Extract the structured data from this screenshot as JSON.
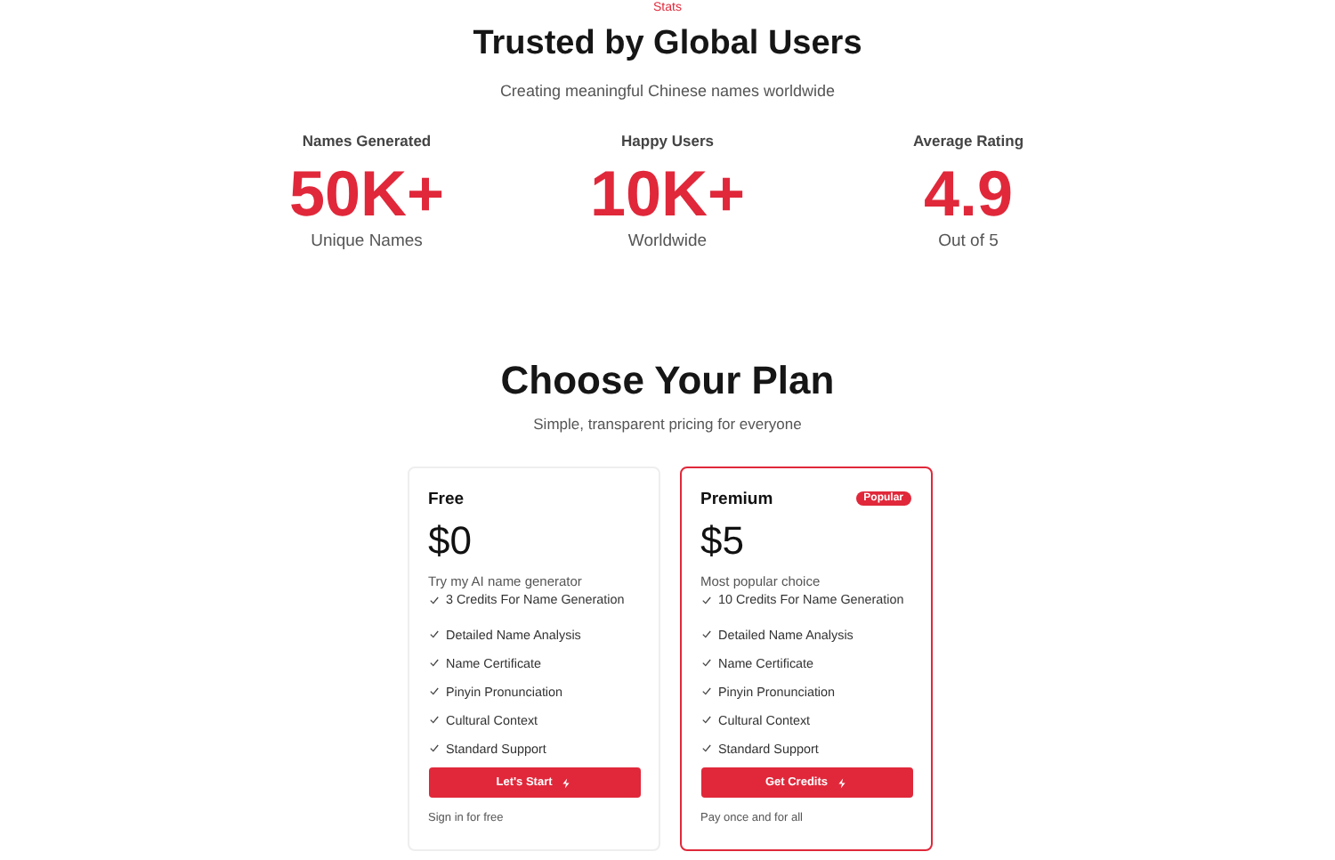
{
  "stats_section": {
    "eyebrow": "Stats",
    "title": "Trusted by Global Users",
    "subtitle": "Creating meaningful Chinese names worldwide",
    "stats": [
      {
        "label": "Names Generated",
        "value": "50K+",
        "caption": "Unique Names"
      },
      {
        "label": "Happy Users",
        "value": "10K+",
        "caption": "Worldwide"
      },
      {
        "label": "Average Rating",
        "value": "4.9",
        "caption": "Out of 5"
      }
    ]
  },
  "pricing": {
    "title": "Choose Your Plan",
    "subtitle": "Simple, transparent pricing for everyone",
    "plans": [
      {
        "name": "Free",
        "price": "$0",
        "description": "Try my AI name generator",
        "featured": false,
        "features": [
          "3 Credits For Name Generation",
          "Detailed Name Analysis",
          "Name Certificate",
          "Pinyin Pronunciation",
          "Cultural Context",
          "Standard Support"
        ],
        "button": "Let's Start",
        "note": "Sign in for free"
      },
      {
        "name": "Premium",
        "badge": "Popular",
        "price": "$5",
        "description": "Most popular choice",
        "featured": true,
        "features": [
          "10 Credits For Name Generation",
          "Detailed Name Analysis",
          "Name Certificate",
          "Pinyin Pronunciation",
          "Cultural Context",
          "Standard Support"
        ],
        "button": "Get Credits",
        "note": "Pay once and for all"
      }
    ]
  }
}
